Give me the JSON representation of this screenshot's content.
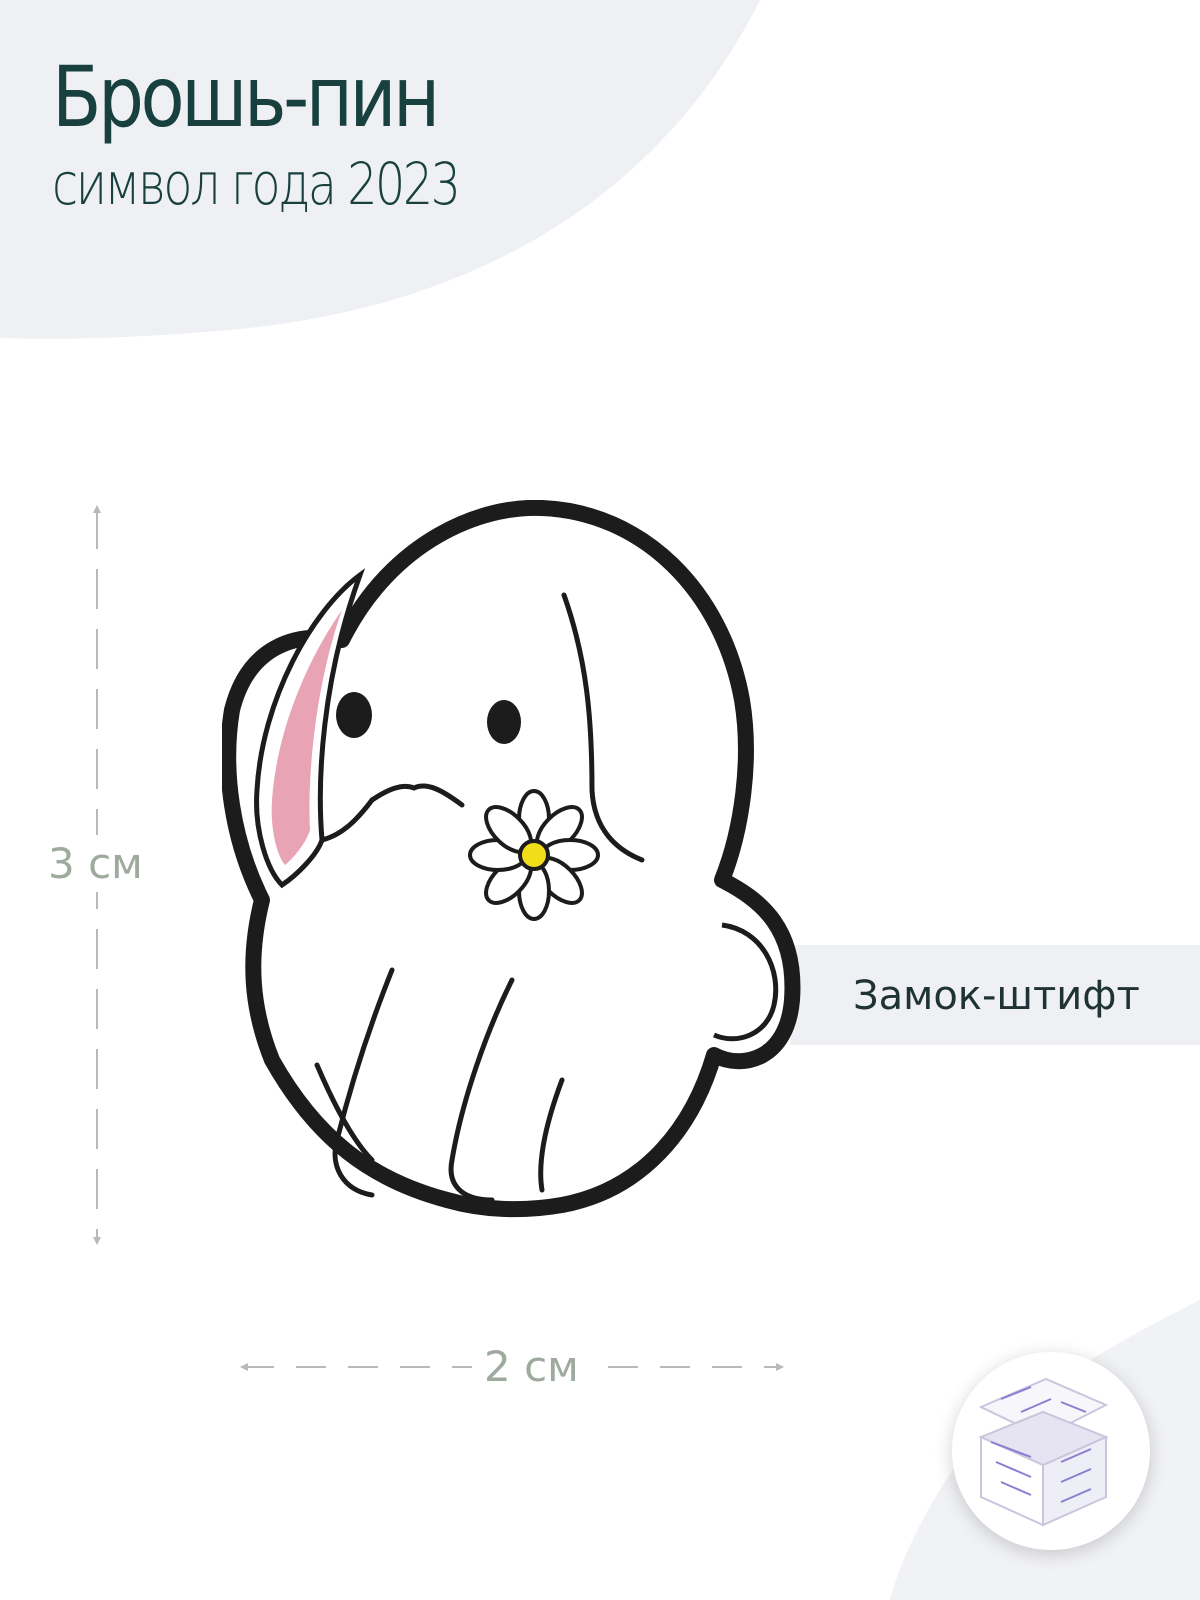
{
  "title": "Брошь-пин",
  "subtitle": "символ года 2023",
  "dimensions": {
    "height_label": "3 см",
    "width_label": "2 см"
  },
  "features": {
    "lock_label": "Замок-штифт"
  },
  "product": {
    "description_icon": "bunny-pin-icon",
    "colors": {
      "outline": "#1c1c1c",
      "enamel": "#ffffff",
      "ear_inner": "#e8a3b5",
      "flower_center": "#f2dd1a"
    }
  },
  "packaging_icon": "gift-box-icon",
  "colors": {
    "title": "#17403f",
    "dimension_text": "#9eaa9e",
    "panel_bg": "#eff0f4"
  }
}
